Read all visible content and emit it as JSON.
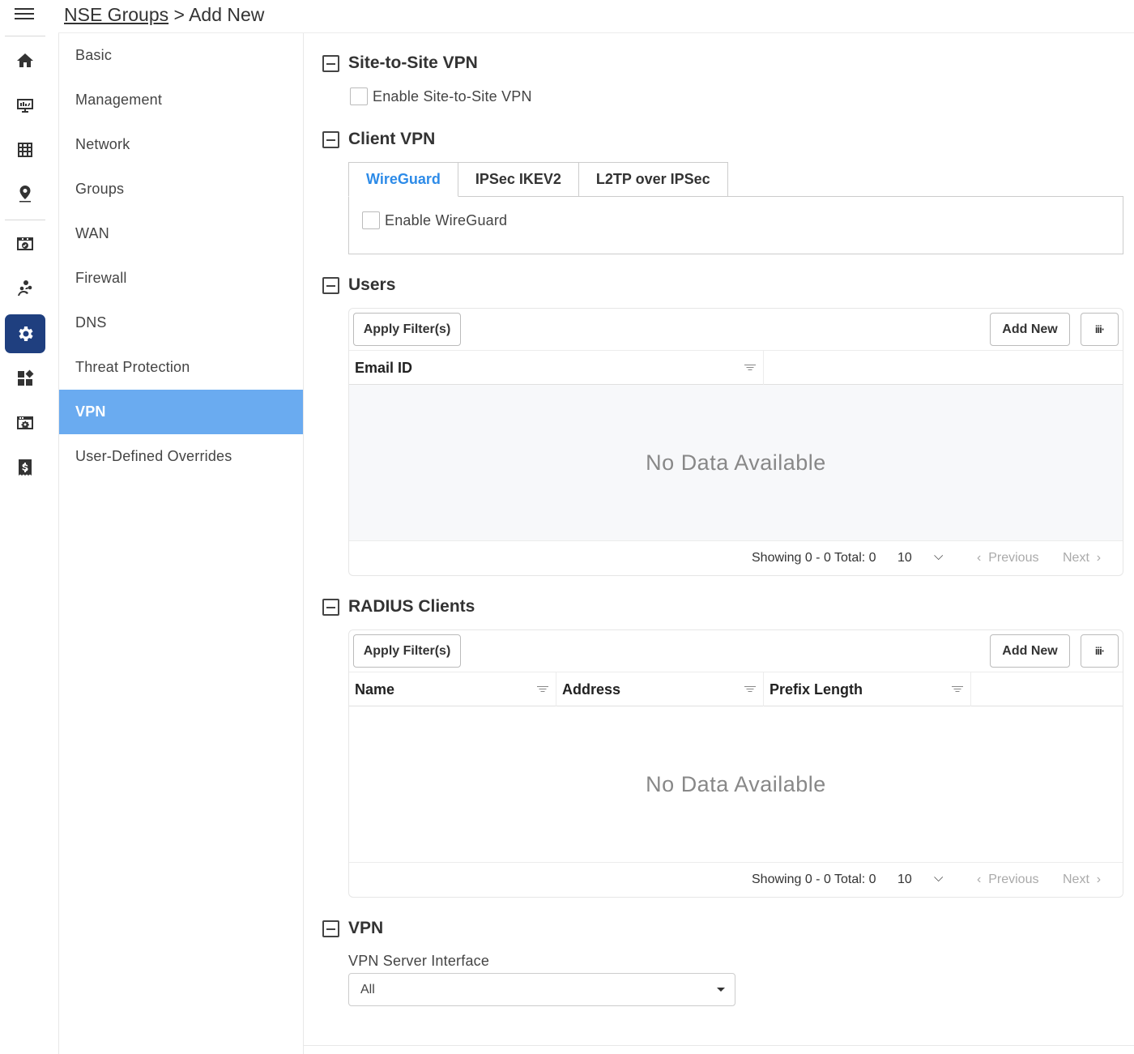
{
  "breadcrumb": {
    "parent": "NSE Groups",
    "separator": ">",
    "current": "Add New"
  },
  "rail": {
    "items": [
      "home-icon",
      "monitor-icon",
      "table-icon",
      "location-pin-icon",
      "calendar-check-icon",
      "users-network-icon",
      "gear-icon",
      "widgets-icon",
      "settings-window-icon",
      "billing-icon"
    ],
    "active": "gear-icon",
    "active_color": "#1f3f7f"
  },
  "secnav": {
    "items": [
      {
        "label": "Basic"
      },
      {
        "label": "Management"
      },
      {
        "label": "Network"
      },
      {
        "label": "Groups"
      },
      {
        "label": "WAN"
      },
      {
        "label": "Firewall"
      },
      {
        "label": "DNS"
      },
      {
        "label": "Threat Protection"
      },
      {
        "label": "VPN"
      },
      {
        "label": "User-Defined Overrides"
      }
    ],
    "active": "VPN",
    "active_color": "#6aabf0"
  },
  "site_to_site": {
    "title": "Site-to-Site VPN",
    "checkbox_label": "Enable Site-to-Site VPN",
    "checked": false
  },
  "client_vpn": {
    "title": "Client VPN",
    "tabs": [
      "WireGuard",
      "IPSec IKEV2",
      "L2TP over IPSec"
    ],
    "active_tab": "WireGuard",
    "active_tab_color": "#2d8be8",
    "checkbox_label": "Enable WireGuard",
    "checked": false
  },
  "users": {
    "title": "Users",
    "apply_filters": "Apply Filter(s)",
    "add_new": "Add New",
    "columns_icon": "iii·",
    "columns": [
      "Email ID"
    ],
    "empty_text": "No Data Available",
    "footer": {
      "showing": "Showing 0 - 0 Total: 0",
      "page_size": "10",
      "previous": "Previous",
      "next": "Next"
    }
  },
  "radius": {
    "title": "RADIUS Clients",
    "apply_filters": "Apply Filter(s)",
    "add_new": "Add New",
    "columns_icon": "iii·",
    "columns": [
      "Name",
      "Address",
      "Prefix Length"
    ],
    "empty_text": "No Data Available",
    "footer": {
      "showing": "Showing 0 - 0 Total: 0",
      "page_size": "10",
      "previous": "Previous",
      "next": "Next"
    }
  },
  "vpn": {
    "title": "VPN",
    "field_label": "VPN Server Interface",
    "field_value": "All"
  }
}
